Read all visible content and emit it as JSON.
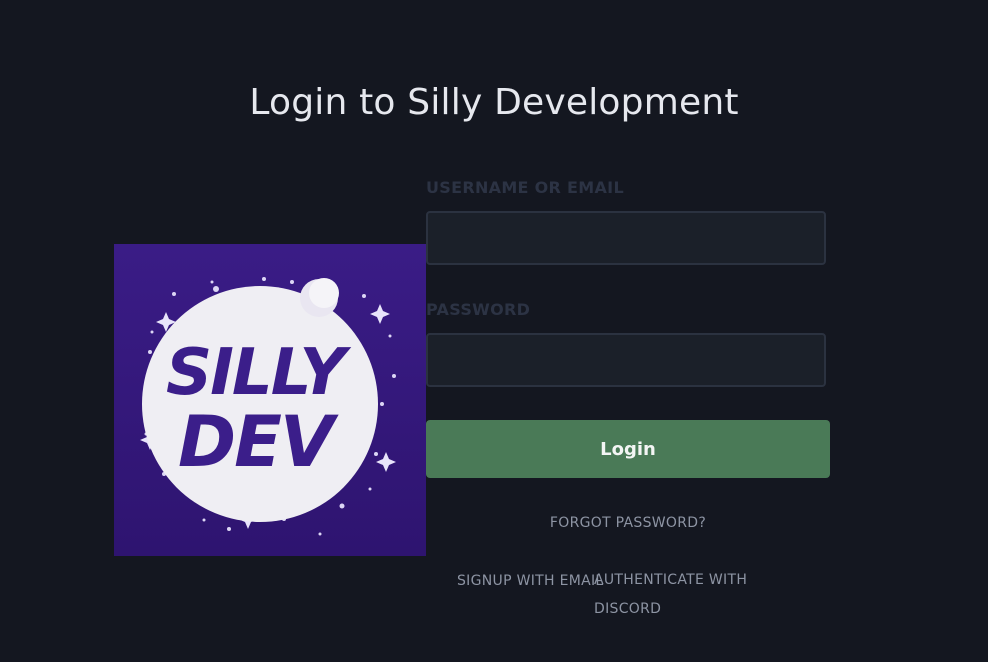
{
  "page": {
    "title": "Login to Silly Development"
  },
  "logo": {
    "line1": "SILLY",
    "line2": "DEV",
    "bg_color": "#34197a",
    "moon_color": "#efeef3"
  },
  "form": {
    "username_label": "USERNAME OR EMAIL",
    "username_value": "",
    "password_label": "PASSWORD",
    "password_value": "",
    "login_label": "Login",
    "login_color": "#4a7a57"
  },
  "links": {
    "forgot_password": "FORGOT PASSWORD?",
    "signup_email": "SIGNUP WITH EMAIL",
    "authenticate_discord": "AUTHENTICATE WITH DISCORD"
  }
}
